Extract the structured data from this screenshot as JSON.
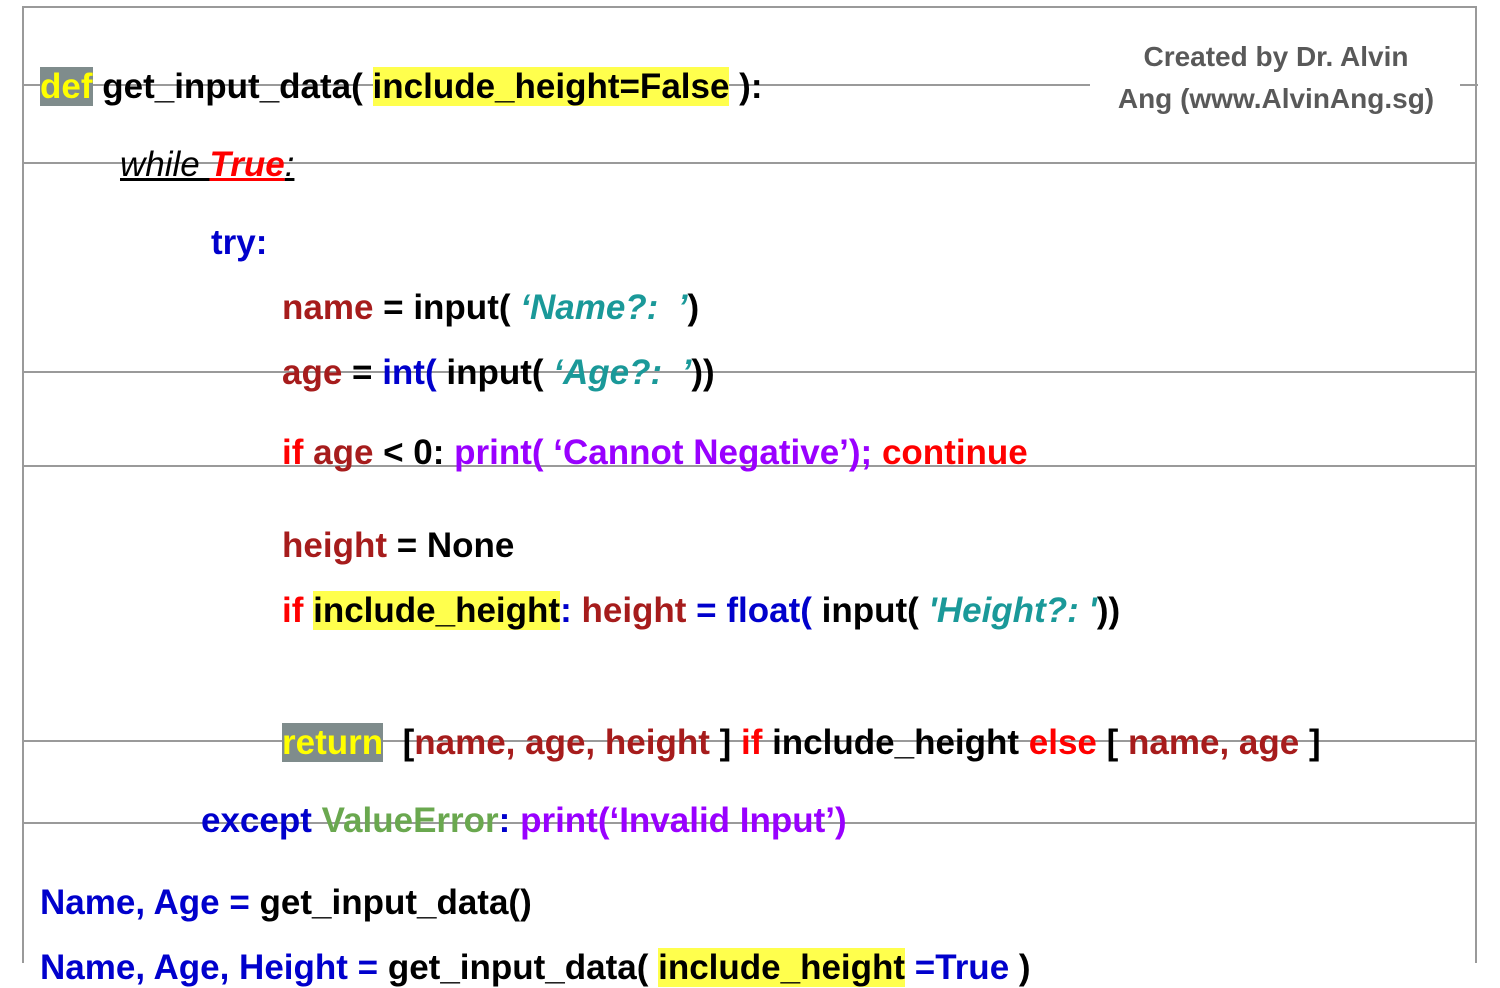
{
  "credit": {
    "line1": "Created by Dr. Alvin",
    "line2": "Ang (www.AlvinAng.sg)"
  },
  "def_line": {
    "def_kw": "def",
    "fn": " get_input_data( ",
    "param": "include_height=False",
    "close": " ):"
  },
  "while_line": {
    "while_kw": "while ",
    "true_kw": "True",
    "colon": ":"
  },
  "try_line": {
    "try_kw": "try:"
  },
  "name_line": {
    "var": "name",
    "eq": " = input( ",
    "str": "‘Name?:  ’",
    "close": ")"
  },
  "age_line": {
    "var": "age",
    "eq": " = ",
    "int_fn": "int(",
    "inp": " input( ",
    "str": "‘Age?:  ’",
    "close": "))"
  },
  "if_line": {
    "if_kw": "if ",
    "var": "age",
    "cmp": " < 0: ",
    "print": "print( ‘Cannot Negative’); ",
    "cont": "continue"
  },
  "height_line": {
    "var": "height",
    "eq": " = None"
  },
  "if_height_line": {
    "if_kw": "if ",
    "param": "include_height",
    "colon": ": ",
    "var": "height",
    "eq": " = float( ",
    "inp": "input( ",
    "str": "'Height?: '",
    "close": "))"
  },
  "return_line": {
    "ret_kw": "return",
    "sp": "  [",
    "list1": "name, age, height",
    "mid": " ] ",
    "if_kw": "if",
    "cond": " include_height ",
    "else_kw": "else",
    "open2": " [ ",
    "list2": "name, age",
    "close2": " ]"
  },
  "except_line": {
    "exc_kw": "except ",
    "err": "ValueError",
    "colon": ": ",
    "print": "print(‘Invalid Input’)"
  },
  "call1": {
    "vars": "Name, Age = ",
    "call": "get_input_data()"
  },
  "call2": {
    "vars": "Name, Age, Height = ",
    "call": "get_input_data( ",
    "param": "include_height",
    "eq": " =True",
    "close": " )"
  }
}
